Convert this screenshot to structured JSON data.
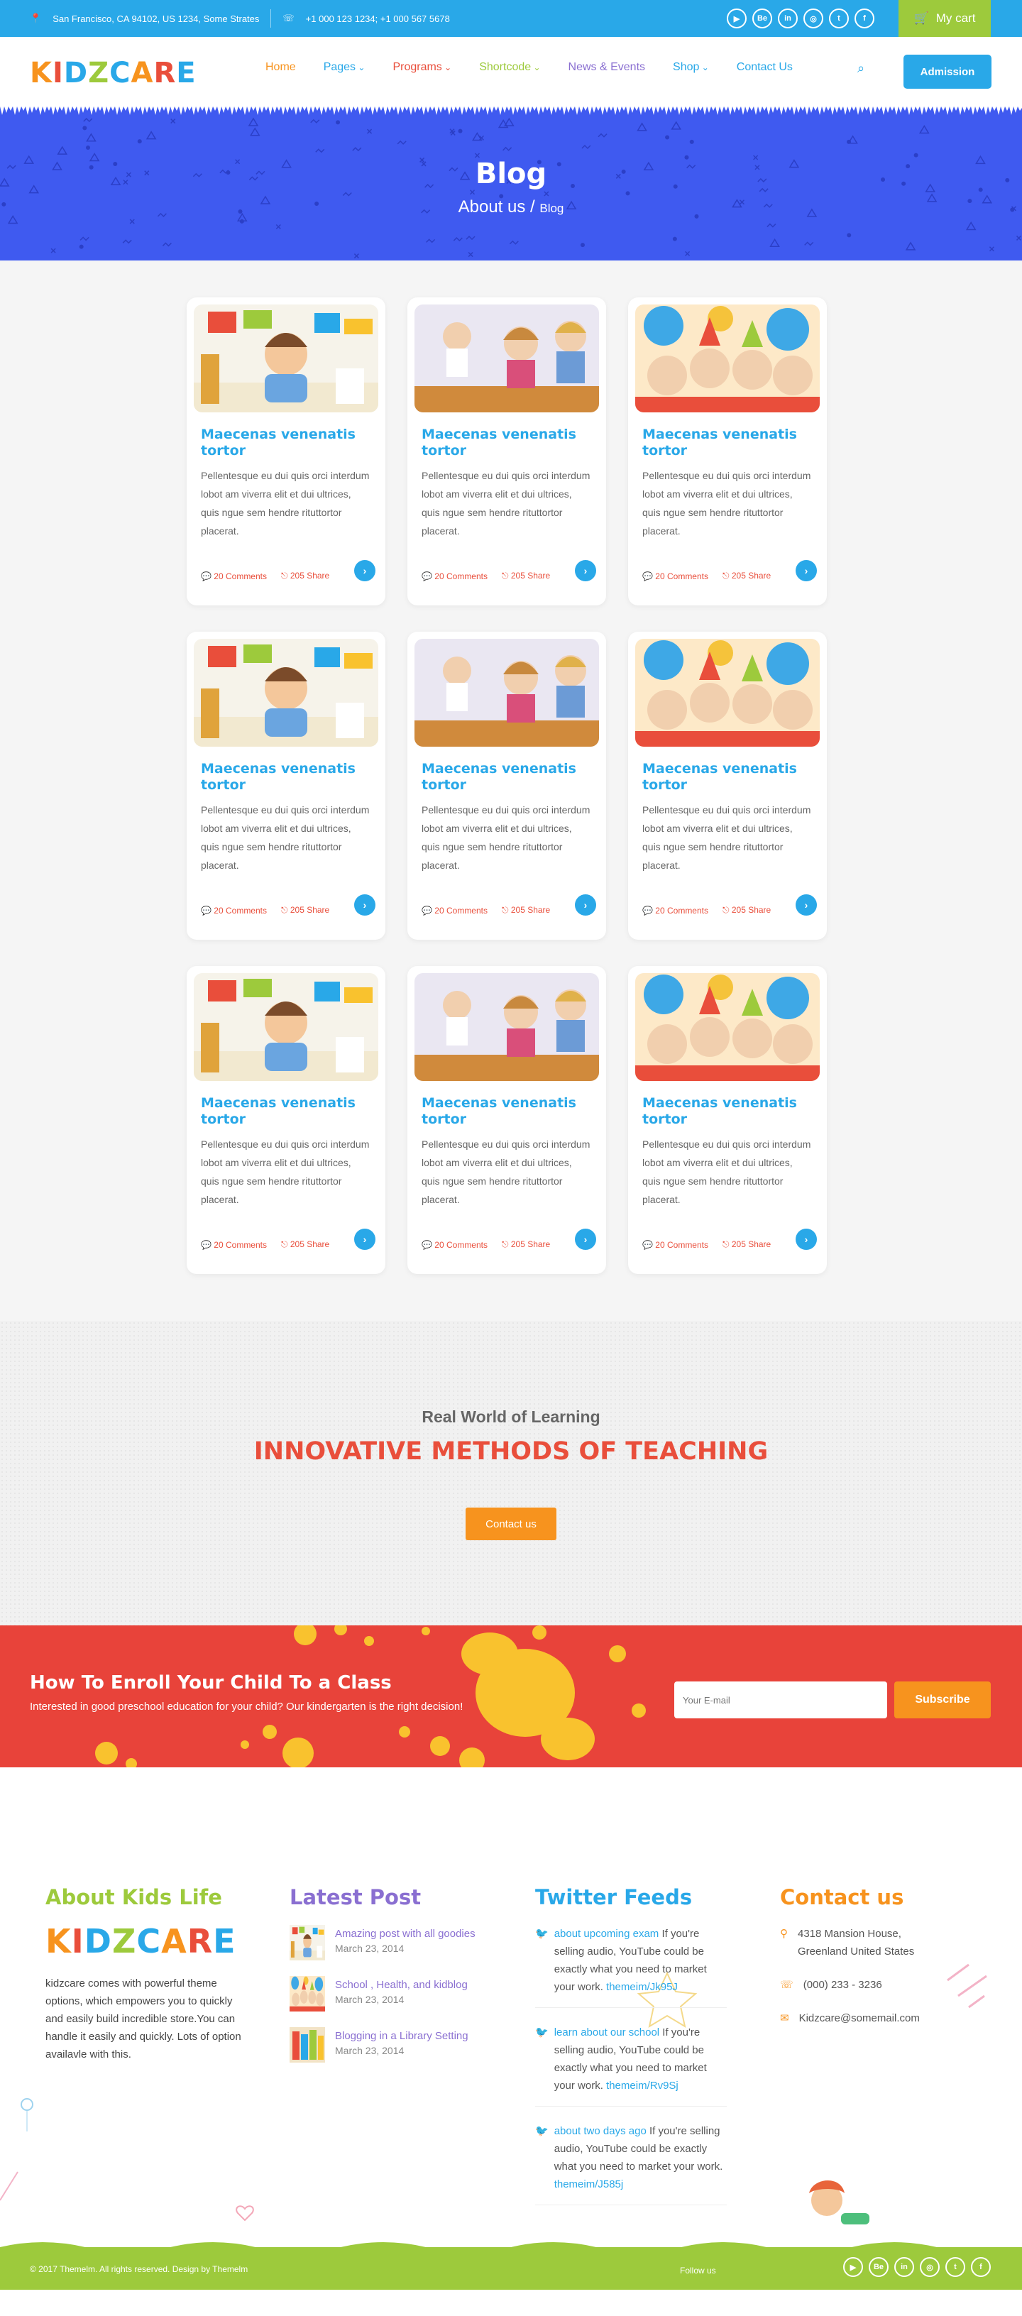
{
  "topbar": {
    "address": "San Francisco, CA 94102, US 1234, Some Strates",
    "phone": "+1 000 123 1234; +1 000 567 5678",
    "socials": [
      "youtube-icon",
      "behance-icon",
      "linkedin-icon",
      "instagram-icon",
      "twitter-icon",
      "facebook-icon"
    ],
    "social_glyphs": [
      "▶",
      "Be",
      "in",
      "◎",
      "t",
      "f"
    ],
    "cart_label": "My cart"
  },
  "nav": {
    "logo": [
      "K",
      "I",
      "D",
      "Z",
      "C",
      "A",
      "R",
      "E"
    ],
    "logo_colors": [
      "#f7931e",
      "#e94e3b",
      "#29a8e8",
      "#9dca3c",
      "#29a8e8",
      "#f7931e",
      "#e94e3b",
      "#29a8e8"
    ],
    "items": [
      {
        "label": "Home",
        "color": "#f7931e",
        "dropdown": false
      },
      {
        "label": "Pages",
        "color": "#29a8e8",
        "dropdown": true
      },
      {
        "label": "Programs",
        "color": "#e94e3b",
        "dropdown": true
      },
      {
        "label": "Shortcode",
        "color": "#9dca3c",
        "dropdown": true
      },
      {
        "label": "News & Events",
        "color": "#8a6fd1",
        "dropdown": false
      },
      {
        "label": "Shop",
        "color": "#29a8e8",
        "dropdown": true
      },
      {
        "label": "Contact Us",
        "color": "#29a8e8",
        "dropdown": false
      }
    ],
    "admission_label": "Admission"
  },
  "banner": {
    "title": "Blog",
    "crumb_parent": "About us",
    "crumb_sep": " / ",
    "crumb_current": "Blog"
  },
  "posts": [
    {
      "title": "Maecenas venenatis tortor",
      "excerpt": "Pellentesque eu dui quis orci interdum lobot am viverra elit et dui ultrices, quis ngue sem hendre rituttortor placerat.",
      "comments": "20 Comments",
      "share": "205 Share",
      "image": "boy-drawing"
    },
    {
      "title": "Maecenas venenatis tortor",
      "excerpt": "Pellentesque eu dui quis orci interdum lobot am viverra elit et dui ultrices, quis ngue sem hendre rituttortor placerat.",
      "comments": "20 Comments",
      "share": "205 Share",
      "image": "classroom"
    },
    {
      "title": "Maecenas venenatis tortor",
      "excerpt": "Pellentesque eu dui quis orci interdum lobot am viverra elit et dui ultrices, quis ngue sem hendre rituttortor placerat.",
      "comments": "20 Comments",
      "share": "205 Share",
      "image": "party"
    },
    {
      "title": "Maecenas venenatis tortor",
      "excerpt": "Pellentesque eu dui quis orci interdum lobot am viverra elit et dui ultrices, quis ngue sem hendre rituttortor placerat.",
      "comments": "20 Comments",
      "share": "205 Share",
      "image": "boy-drawing"
    },
    {
      "title": "Maecenas venenatis tortor",
      "excerpt": "Pellentesque eu dui quis orci interdum lobot am viverra elit et dui ultrices, quis ngue sem hendre rituttortor placerat.",
      "comments": "20 Comments",
      "share": "205 Share",
      "image": "classroom"
    },
    {
      "title": "Maecenas venenatis tortor",
      "excerpt": "Pellentesque eu dui quis orci interdum lobot am viverra elit et dui ultrices, quis ngue sem hendre rituttortor placerat.",
      "comments": "20 Comments",
      "share": "205 Share",
      "image": "party"
    },
    {
      "title": "Maecenas venenatis tortor",
      "excerpt": "Pellentesque eu dui quis orci interdum lobot am viverra elit et dui ultrices, quis ngue sem hendre rituttortor placerat.",
      "comments": "20 Comments",
      "share": "205 Share",
      "image": "boy-drawing"
    },
    {
      "title": "Maecenas venenatis tortor",
      "excerpt": "Pellentesque eu dui quis orci interdum lobot am viverra elit et dui ultrices, quis ngue sem hendre rituttortor placerat.",
      "comments": "20 Comments",
      "share": "205 Share",
      "image": "classroom"
    },
    {
      "title": "Maecenas venenatis tortor",
      "excerpt": "Pellentesque eu dui quis orci interdum lobot am viverra elit et dui ultrices, quis ngue sem hendre rituttortor placerat.",
      "comments": "20 Comments",
      "share": "205 Share",
      "image": "party"
    }
  ],
  "learning": {
    "subtitle": "Real World of Learning",
    "title": "INNOVATIVE METHODS OF TEACHING",
    "button": "Contact us"
  },
  "enroll": {
    "title": "How To Enroll Your Child To a Class",
    "text": "Interested in good preschool education for your child? Our kindergarten is the right decision!",
    "placeholder": "Your E-mail",
    "button": "Subscribe"
  },
  "footer": {
    "about": {
      "heading": "About Kids Life",
      "text": "kidzcare comes with powerful theme options, which empowers you to quickly and easily build incredible store.You can handle it easily and quickly. Lots of option availavle with this."
    },
    "latest": {
      "heading": "Latest Post",
      "posts": [
        {
          "title": "Amazing post with all goodies",
          "date": "March 23, 2014",
          "image": "boy-drawing"
        },
        {
          "title": "School , Health, and kidblog",
          "date": "March 23, 2014",
          "image": "party"
        },
        {
          "title": "Blogging in a Library Setting",
          "date": "March 23, 2014",
          "image": "library"
        }
      ]
    },
    "twitter": {
      "heading": "Twitter Feeds",
      "tweets": [
        {
          "lead": "about upcoming exam",
          "text": " If you're selling audio, YouTube could be exactly what you need to market your work. ",
          "link": "themeim/Jk95J"
        },
        {
          "lead": "learn about our school",
          "text": " If you're selling audio, YouTube could be exactly what you need to market your work. ",
          "link": "themeim/Rv9Sj"
        },
        {
          "lead": "about two days ago",
          "text": " If you're selling audio, YouTube could be exactly what you need to market your work. ",
          "link": "themeim/J585j"
        }
      ]
    },
    "contact": {
      "heading": "Contact us",
      "address": "4318 Mansion House, Greenland United States",
      "phone": "(000) 233 - 3236",
      "email": "Kidzcare@somemail.com"
    },
    "copyright": "© 2017 Themelm. All rights reserved. Design by Themelm",
    "follow": "Follow us"
  }
}
